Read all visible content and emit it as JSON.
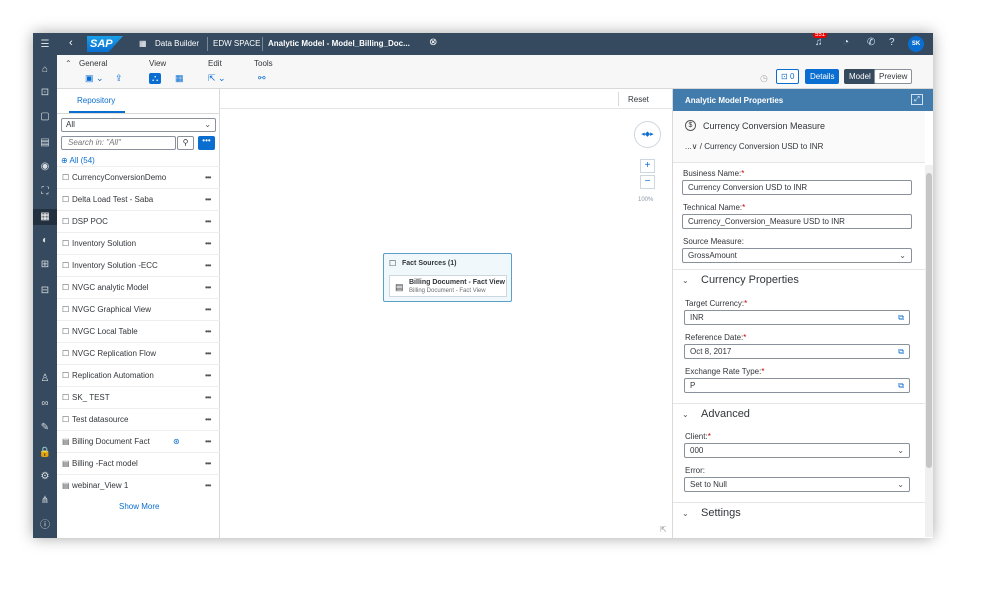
{
  "shell": {
    "app_name": "Data Builder",
    "space": "EDW SPACE",
    "doc_title": "Analytic Model - Model_Billing_Doc...",
    "logo": "SAP",
    "notifications": "551",
    "avatar": "SK"
  },
  "toolbar": {
    "general": "General",
    "view": "View",
    "edit": "Edit",
    "tools": "Tools",
    "errors_count": "0",
    "details": "Details",
    "model": "Model",
    "preview": "Preview"
  },
  "repository": {
    "tab": "Repository",
    "filter": "All",
    "search_placeholder": "Search in: \"All\"",
    "all_count": "All (54)",
    "items": [
      {
        "label": "CurrencyConversionDemo",
        "icon": "folder"
      },
      {
        "label": "Delta Load Test - Saba",
        "icon": "folder"
      },
      {
        "label": "DSP POC",
        "icon": "folder"
      },
      {
        "label": "Inventory Solution",
        "icon": "folder"
      },
      {
        "label": "Inventory Solution -ECC",
        "icon": "folder"
      },
      {
        "label": "NVGC analytic Model",
        "icon": "folder"
      },
      {
        "label": "NVGC Graphical View",
        "icon": "folder"
      },
      {
        "label": "NVGC Local Table",
        "icon": "folder"
      },
      {
        "label": "NVGC Replication Flow",
        "icon": "folder"
      },
      {
        "label": "Replication Automation",
        "icon": "folder"
      },
      {
        "label": "SK_ TEST",
        "icon": "folder"
      },
      {
        "label": "Test datasource",
        "icon": "folder"
      },
      {
        "label": "Billing Document Fact",
        "icon": "view"
      },
      {
        "label": "Billing -Fact model",
        "icon": "view"
      },
      {
        "label": "webinar_View 1",
        "icon": "view"
      }
    ],
    "show_more": "Show More"
  },
  "canvas": {
    "reset": "Reset",
    "zoom": "100%",
    "fact_sources_title": "Fact Sources (1)",
    "fact_name": "Billing Document - Fact View",
    "fact_sub": "Billing Document - Fact View"
  },
  "properties": {
    "header": "Analytic Model Properties",
    "measure_title": "Currency Conversion Measure",
    "measure_path": "...∨ / Currency Conversion USD to INR",
    "business_name_label": "Business Name:",
    "business_name": "Currency Conversion USD to INR",
    "technical_name_label": "Technical Name:",
    "technical_name": "Currency_Conversion_Measure USD to INR",
    "source_measure_label": "Source Measure:",
    "source_measure": "GrossAmount",
    "currency_section": "Currency Properties",
    "target_currency_label": "Target Currency:",
    "target_currency": "INR",
    "reference_date_label": "Reference Date:",
    "reference_date": "Oct 8, 2017",
    "exchange_rate_label": "Exchange Rate Type:",
    "exchange_rate": "P",
    "advanced_section": "Advanced",
    "client_label": "Client:",
    "client": "000",
    "error_label": "Error:",
    "error": "Set to Null",
    "settings_section": "Settings",
    "required_mark": "*"
  }
}
